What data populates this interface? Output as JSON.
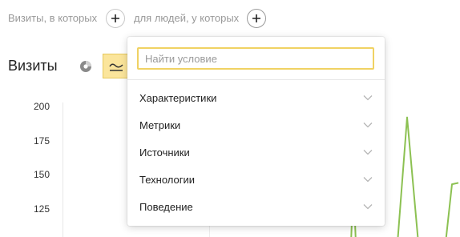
{
  "filter": {
    "visits_label": "Визиты, в которых",
    "people_label": "для людей, у которых"
  },
  "chart": {
    "title": "Визиты"
  },
  "chart_data": {
    "type": "line",
    "yticks": [
      "200",
      "175",
      "150",
      "125"
    ],
    "ylim": [
      100,
      200
    ],
    "series": [
      {
        "color": "#8cc152",
        "points": [
          [
            438,
            100
          ],
          [
            441,
            145
          ],
          [
            444,
            100
          ],
          [
            450,
            100
          ],
          [
            496,
            100
          ],
          [
            508,
            192
          ],
          [
            522,
            100
          ],
          [
            556,
            100
          ],
          [
            564,
            143
          ],
          [
            572,
            144
          ]
        ]
      }
    ]
  },
  "dropdown": {
    "search_placeholder": "Найти условие",
    "items": [
      {
        "label": "Характеристики"
      },
      {
        "label": "Метрики"
      },
      {
        "label": "Источники"
      },
      {
        "label": "Технологии"
      },
      {
        "label": "Поведение"
      }
    ]
  },
  "colors": {
    "line": "#8cc152",
    "active_toggle": "#fbe59b",
    "search_border": "#f0d263"
  },
  "icons": {
    "add_visits": "plus-icon",
    "add_people": "plus-icon",
    "pie": "pie-chart-icon",
    "line": "line-chart-icon",
    "chevron": "chevron-down-icon"
  }
}
